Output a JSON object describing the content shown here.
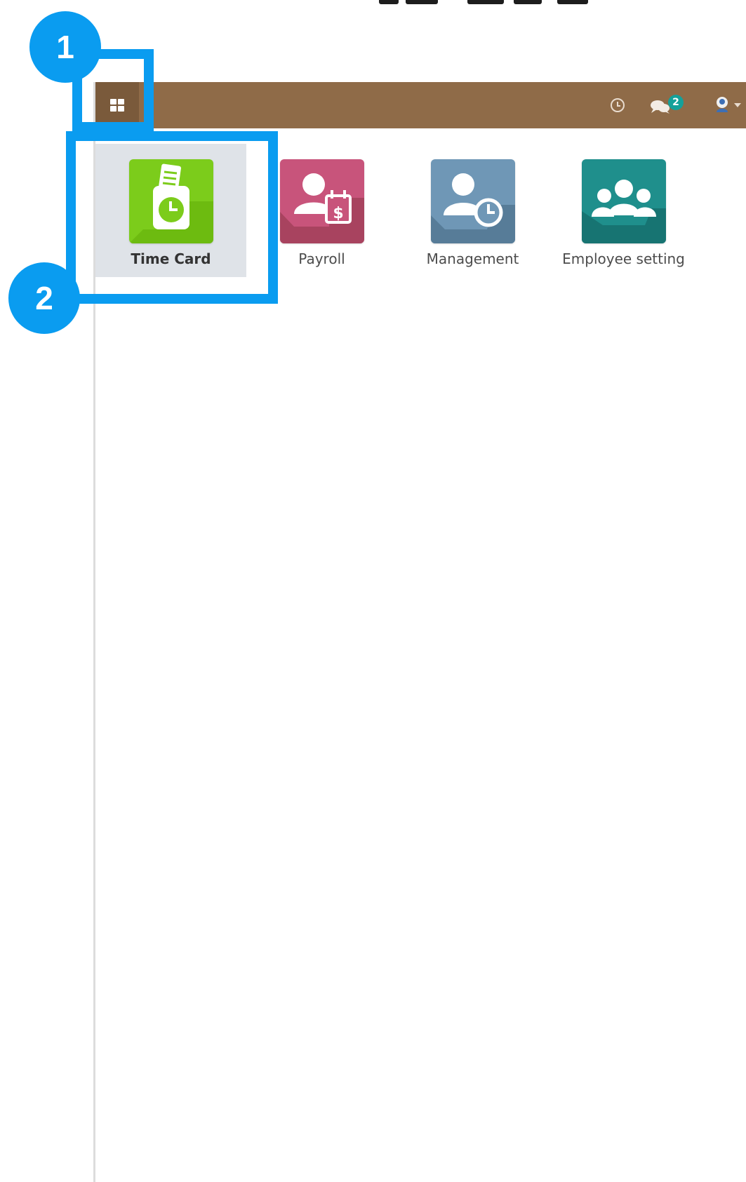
{
  "colors": {
    "navbar": "#8f6b48",
    "navbar_toggle": "#7a5a3b",
    "highlight": "#0a9cf0",
    "badge": "#14a19a",
    "active_tile_bg": "#dfe3e8"
  },
  "annotations": {
    "step1": "1",
    "step2": "2"
  },
  "navbar": {
    "apps_menu_icon": "grid-icon",
    "clock_icon": "clock-icon",
    "messages_icon": "chat-icon",
    "messages_badge": "2",
    "user_icon": "user-avatar",
    "user_menu_icon": "caret-down-icon"
  },
  "apps": [
    {
      "label": "Time Card",
      "icon": "time-card-icon",
      "color": "#7ccc1b",
      "active": true
    },
    {
      "label": "Payroll",
      "icon": "payroll-icon",
      "color": "#c8547b",
      "active": false
    },
    {
      "label": "Management",
      "icon": "management-icon",
      "color": "#6f97b6",
      "active": false
    },
    {
      "label": "Employee setting",
      "icon": "employee-setting-icon",
      "color": "#1f8f8c",
      "active": false
    }
  ]
}
